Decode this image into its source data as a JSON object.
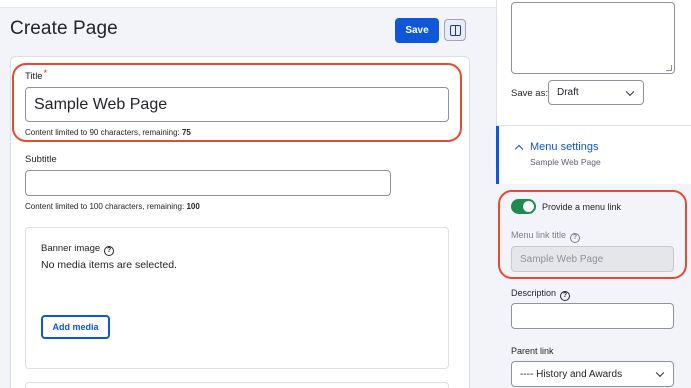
{
  "header": {
    "title": "Create Page",
    "save_label": "Save",
    "sidebar_toggle_icon": "sidebar-panel-icon"
  },
  "form": {
    "title_field": {
      "label": "Title",
      "required_marker": "*",
      "value": "Sample Web Page",
      "help_prefix": "Content limited to 90 characters, remaining:",
      "remaining": "75"
    },
    "subtitle_field": {
      "label": "Subtitle",
      "value": "",
      "help_prefix": "Content limited to 100 characters, remaining:",
      "remaining": "100"
    },
    "banner": {
      "label": "Banner image",
      "help_icon_text": "?",
      "empty_text": "No media items are selected.",
      "add_label": "Add media"
    }
  },
  "sidebar": {
    "save_as": {
      "label": "Save as:",
      "selected": "Draft"
    },
    "menu_settings": {
      "title": "Menu settings",
      "summary": "Sample Web Page",
      "expanded": true,
      "provide_link_label": "Provide a menu link",
      "provide_link_checked": true,
      "link_title_label": "Menu link title",
      "link_title_value": "Sample Web Page",
      "description_label": "Description",
      "description_value": "",
      "parent_label": "Parent link",
      "parent_selected": "---- History and Awards"
    }
  },
  "colors": {
    "accent": "#0d57d8",
    "highlight": "#e84a2e",
    "toggle_on": "#1f8a4f",
    "required": "#dc2323"
  }
}
